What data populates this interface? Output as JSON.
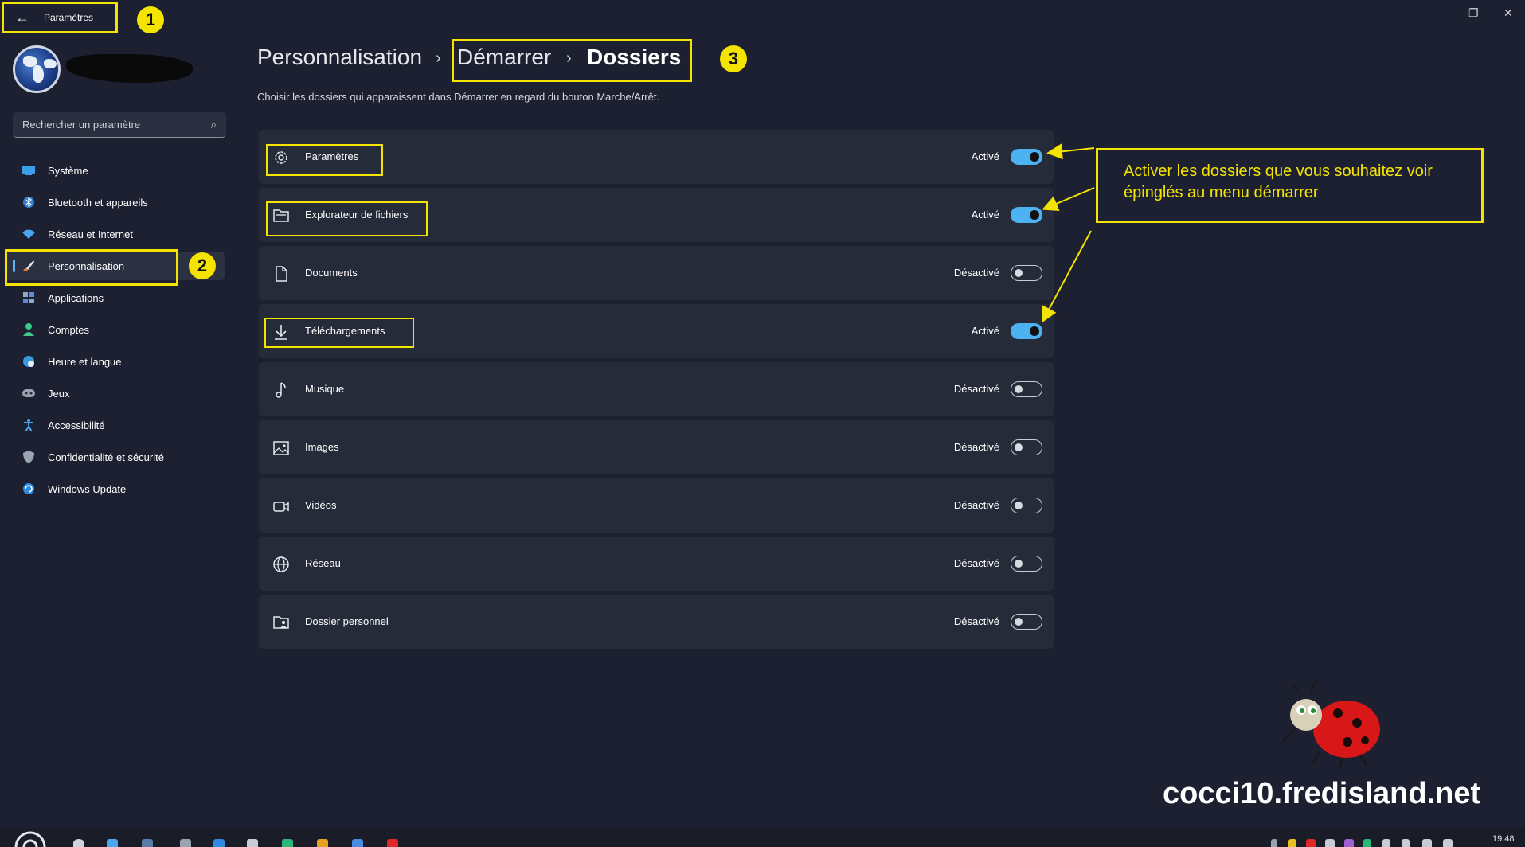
{
  "window": {
    "back_label": "Paramètres"
  },
  "annotations": {
    "n1": "1",
    "n2": "2",
    "n3": "3",
    "callout": "Activer les dossiers que vous souhaitez voir épinglés au menu démarrer",
    "site": "cocci10.fredisland.net"
  },
  "search": {
    "placeholder": "Rechercher un paramètre"
  },
  "sidebar": {
    "items": [
      {
        "label": "Système",
        "icon": "system-icon"
      },
      {
        "label": "Bluetooth et appareils",
        "icon": "bluetooth-icon"
      },
      {
        "label": "Réseau et Internet",
        "icon": "wifi-icon"
      },
      {
        "label": "Personnalisation",
        "icon": "brush-icon"
      },
      {
        "label": "Applications",
        "icon": "apps-icon"
      },
      {
        "label": "Comptes",
        "icon": "account-icon"
      },
      {
        "label": "Heure et langue",
        "icon": "globe-clock-icon"
      },
      {
        "label": "Jeux",
        "icon": "gamepad-icon"
      },
      {
        "label": "Accessibilité",
        "icon": "accessibility-icon"
      },
      {
        "label": "Confidentialité et sécurité",
        "icon": "shield-icon"
      },
      {
        "label": "Windows Update",
        "icon": "update-icon"
      }
    ]
  },
  "breadcrumb": {
    "part1": "Personnalisation",
    "part2": "Démarrer",
    "part3": "Dossiers",
    "sep": "›"
  },
  "description": "Choisir les dossiers qui apparaissent dans Démarrer en regard du bouton Marche/Arrêt.",
  "folders": [
    {
      "label": "Paramètres",
      "state": "Activé",
      "on": true,
      "icon": "gear-icon"
    },
    {
      "label": "Explorateur de fichiers",
      "state": "Activé",
      "on": true,
      "icon": "folder-icon"
    },
    {
      "label": "Documents",
      "state": "Désactivé",
      "on": false,
      "icon": "document-icon"
    },
    {
      "label": "Téléchargements",
      "state": "Activé",
      "on": true,
      "icon": "download-icon"
    },
    {
      "label": "Musique",
      "state": "Désactivé",
      "on": false,
      "icon": "music-icon"
    },
    {
      "label": "Images",
      "state": "Désactivé",
      "on": false,
      "icon": "image-icon"
    },
    {
      "label": "Vidéos",
      "state": "Désactivé",
      "on": false,
      "icon": "video-icon"
    },
    {
      "label": "Réseau",
      "state": "Désactivé",
      "on": false,
      "icon": "network-icon"
    },
    {
      "label": "Dossier personnel",
      "state": "Désactivé",
      "on": false,
      "icon": "user-folder-icon"
    }
  ],
  "taskbar": {
    "clock": "19:48"
  },
  "colors": {
    "accent": "#4cb2f2",
    "highlight": "#f4e400",
    "background": "#1c2030",
    "card": "#262b3a"
  }
}
